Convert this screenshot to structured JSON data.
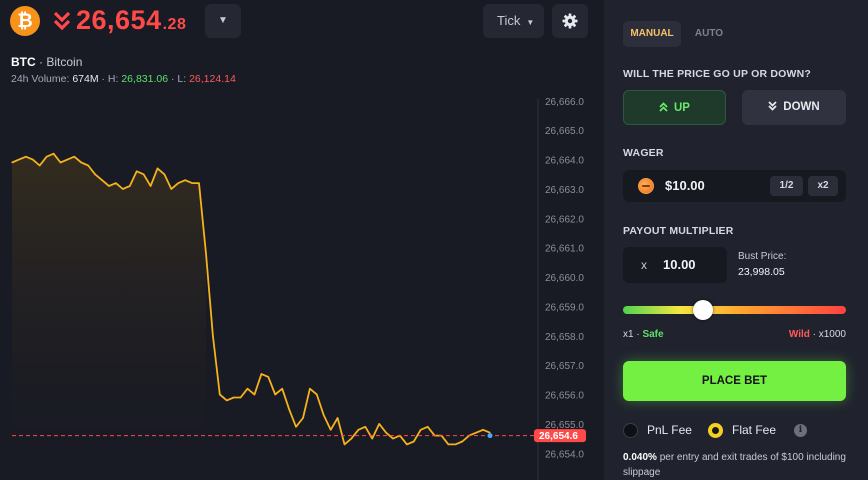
{
  "header": {
    "price_main": "26,654",
    "price_decimals": ".28",
    "price_color": "#ff4a4a",
    "coin_icon": "bitcoin-icon",
    "tick_label": "Tick"
  },
  "pair": {
    "symbol": "BTC",
    "name": "· Bitcoin",
    "volume_label": "24h Volume:",
    "volume_value": "674M",
    "high_label": "· H:",
    "high_value": "26,831.06",
    "low_label": "· L:",
    "low_value": "26,124.14"
  },
  "chart_data": {
    "type": "line",
    "y_axis_ticks": [
      "26,666.0",
      "26,665.0",
      "26,664.0",
      "26,663.0",
      "26,662.0",
      "26,661.0",
      "26,660.0",
      "26,659.0",
      "26,658.0",
      "26,657.0",
      "26,656.0",
      "26,655.0",
      "26,654.0"
    ],
    "ylim": [
      26653.6,
      26666.2
    ],
    "current_price_tag": "26,654.6",
    "current_price": 26654.6,
    "line_color": "#f5b21b",
    "series": [
      {
        "values": [
          26663.9,
          26664.0,
          26664.1,
          26664.0,
          26663.8,
          26664.1,
          26664.2,
          26663.9,
          26664.0,
          26664.1,
          26663.9,
          26663.8,
          26663.5,
          26663.3,
          26663.1,
          26663.2,
          26663.0,
          26663.1,
          26663.6,
          26663.5,
          26663.1,
          26663.7,
          26663.5,
          26663.0,
          26663.2,
          26663.3,
          26663.2,
          26663.2,
          26660.8,
          26658.0,
          26656.0,
          26655.8,
          26655.9,
          26655.9,
          26656.2,
          26656.0,
          26656.7,
          26656.6,
          26656.0,
          26656.2,
          26655.5,
          26654.9,
          26655.2,
          26656.2,
          26656.0,
          26655.3,
          26654.8,
          26655.2,
          26654.3,
          26654.5,
          26654.8,
          26654.9,
          26654.5,
          26655.0,
          26654.7,
          26654.5,
          26654.6,
          26654.3,
          26654.4,
          26654.8,
          26654.9,
          26654.6,
          26654.6,
          26654.3,
          26654.3,
          26654.4,
          26654.6,
          26654.7,
          26654.8,
          26654.7
        ]
      }
    ]
  },
  "panel": {
    "tab_manual": "MANUAL",
    "tab_auto": "AUTO",
    "question": "WILL THE PRICE GO UP OR DOWN?",
    "up_label": "UP",
    "down_label": "DOWN",
    "up_color": "#69e86d",
    "wager_label": "WAGER",
    "wager_value": "$10.00",
    "half_label": "1/2",
    "double_label": "x2",
    "payout_label": "PAYOUT MULTIPLIER",
    "mult_prefix": "x",
    "mult_value": "10.00",
    "bust_label": "Bust Price:",
    "bust_value": "23,998.05",
    "slider_level": 0.36,
    "range_min": "x1",
    "range_min_tag": "Safe",
    "range_max_tag": "Wild",
    "range_max": "x1000",
    "place_bet": "PLACE BET",
    "place_bet_color": "#74f043",
    "fee_pnl": "PnL Fee",
    "fee_flat": "Flat Fee",
    "fee_pct": "0.040%",
    "fee_note": "per entry and exit trades of $100 including slippage"
  }
}
